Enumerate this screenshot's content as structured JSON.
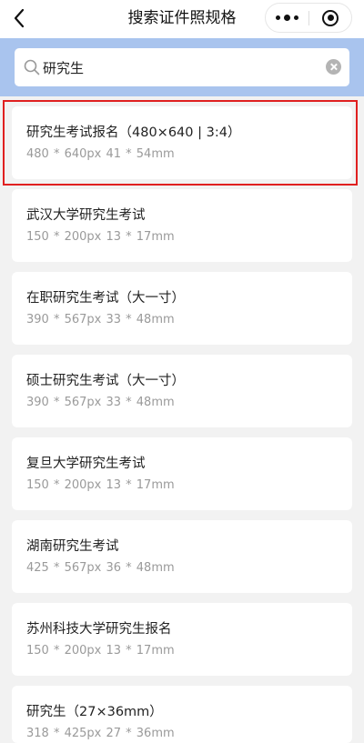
{
  "nav": {
    "title": "搜索证件照规格"
  },
  "search": {
    "value": "研究生",
    "placeholder": ""
  },
  "results": [
    {
      "name": "研究生考试报名（480×640 | 3:4）",
      "size": "480 * 640px   41 * 54mm"
    },
    {
      "name": "武汉大学研究生考试",
      "size": "150 * 200px   13 * 17mm"
    },
    {
      "name": "在职研究生考试（大一寸）",
      "size": "390 * 567px   33 * 48mm"
    },
    {
      "name": "硕士研究生考试（大一寸）",
      "size": "390 * 567px   33 * 48mm"
    },
    {
      "name": "复旦大学研究生考试",
      "size": "150 * 200px   13 * 17mm"
    },
    {
      "name": "湖南研究生考试",
      "size": "425 * 567px   36 * 48mm"
    },
    {
      "name": "苏州科技大学研究生报名",
      "size": "150 * 200px   13 * 17mm"
    },
    {
      "name": "研究生（27×36mm）",
      "size": "318 * 425px   27 * 36mm"
    }
  ],
  "colors": {
    "search_band": "#a9c4ee",
    "highlight": "#e02020",
    "page_bg": "#f2f2f2"
  },
  "icons": {
    "back": "chevron-left-icon",
    "more": "more-dots-icon",
    "close": "target-close-icon",
    "search": "search-icon",
    "clear": "clear-icon"
  }
}
